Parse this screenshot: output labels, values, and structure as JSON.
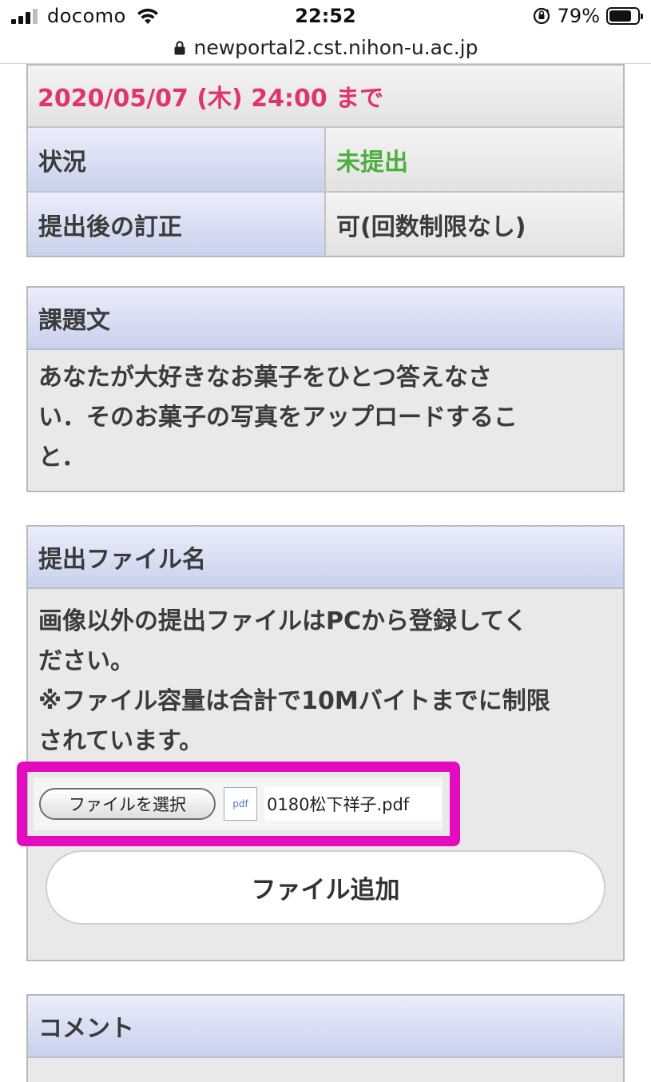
{
  "status_bar": {
    "carrier": "docomo",
    "time": "22:52",
    "battery_percent": "79%",
    "battery_level": 0.79
  },
  "url_bar": {
    "domain": "newportal2.cst.nihon-u.ac.jp"
  },
  "info_table": {
    "deadline": "2020/05/07 (木) 24:00 まで",
    "deadline_color": "#e0356a",
    "rows": [
      {
        "label": "状況",
        "value": "未提出",
        "value_color": "#4caf3f"
      },
      {
        "label": "提出後の訂正",
        "value": "可(回数制限なし)",
        "value_color": "#3b3b3b"
      }
    ]
  },
  "assignment": {
    "heading": "課題文",
    "lines": [
      "あなたが大好きなお菓子をひとつ答えなさ",
      "い．そのお菓子の写真をアップロードするこ",
      "と．"
    ]
  },
  "submission": {
    "heading": "提出ファイル名",
    "lines": [
      "画像以外の提出ファイルはPCから登録してく",
      "ださい。",
      "※ファイル容量は合計で10Mバイトまでに制限",
      "されています。"
    ],
    "choose_button": "ファイルを選択",
    "file_icon_label": "pdf",
    "file_name": "0180松下祥子.pdf",
    "add_button": "ファイル追加",
    "highlight_color": "#e40bbf"
  },
  "comment": {
    "heading": "コメント"
  }
}
